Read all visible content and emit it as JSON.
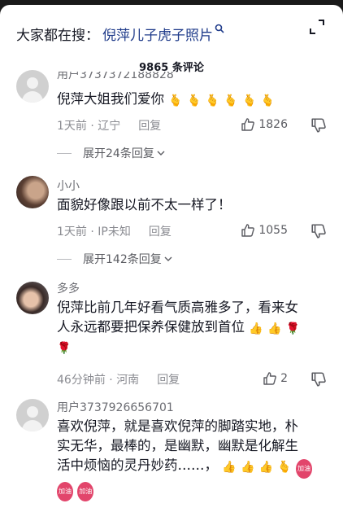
{
  "search": {
    "prefix": "大家都在搜：",
    "term": "倪萍儿子虎子照片"
  },
  "header": {
    "comment_count": "9865 条评论"
  },
  "comments": [
    {
      "username": "用户3737372188828",
      "text": "倪萍大姐我们爱你",
      "emojis": [
        "🫰",
        "🫰",
        "🫰",
        "🫰",
        "🫰",
        "🫰"
      ],
      "time": "1天前",
      "location": "辽宁",
      "reply_label": "回复",
      "likes": "1826",
      "expand_label": "展开24条回复"
    },
    {
      "username": "小小",
      "text": "面貌好像跟以前不太一样了！",
      "time": "1天前",
      "location": "IP未知",
      "reply_label": "回复",
      "likes": "1055",
      "expand_label": "展开142条回复"
    },
    {
      "username": "多多",
      "text_line1": "倪萍比前几年好看气质高雅多了，看来女",
      "text_line2": "人永远都要把保养保健放到首位",
      "emojis": [
        "👍",
        "👍",
        "🌹",
        "🌹"
      ],
      "time": "46分钟前",
      "location": "河南",
      "reply_label": "回复",
      "likes": "2"
    },
    {
      "username": "用户3737926656701",
      "text_line1": "喜欢倪萍，就是喜欢倪萍的脚踏实地，朴",
      "text_line2": "实无华，最棒的，是幽默，幽默是化解生",
      "text_line3": "活中烦恼的灵丹妙药……，",
      "emojis": [
        "👍",
        "👍",
        "👍",
        "🫰",
        "加油",
        "加油",
        "加油"
      ]
    }
  ],
  "colors": {
    "link": "#1f3b8a",
    "muted": "#8a8b91",
    "text": "#161823"
  }
}
